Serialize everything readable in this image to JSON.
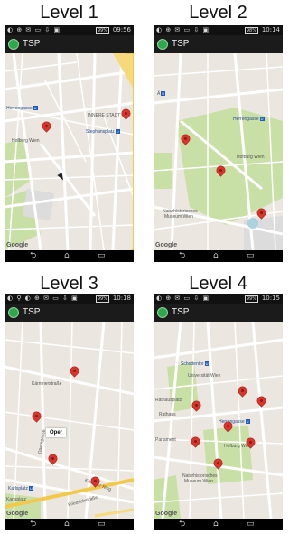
{
  "panels": [
    {
      "title": "Level 1",
      "status": {
        "left_icons": "◐ ⊕ ✉ ▭ ⇩ ▣",
        "right_icons": "⚲ ≪ ⧖ ✈",
        "battery": "99%",
        "time": "09:56"
      },
      "app": {
        "title": "TSP"
      },
      "labels": {
        "a": "Herrengasse",
        "b": "INNERE STADT",
        "c": "Stephansplatz",
        "d": "Hofburg Wien"
      },
      "google": "Google",
      "nav": {
        "back": "⮌",
        "home": "⌂",
        "recent": "▭"
      }
    },
    {
      "title": "Level 2",
      "status": {
        "left_icons": "◐ ⊕ ✉ ▭ ⇩ ▣",
        "right_icons": "≪ ⧖ ✈",
        "battery": "98%",
        "time": "10:14"
      },
      "app": {
        "title": "TSP"
      },
      "labels": {
        "a": "Herrengasse",
        "b": "Hofburg Wien",
        "c": "Naturhistorisches",
        "d": "Museum Wien"
      },
      "google": "Google",
      "nav": {
        "back": "⮌",
        "home": "⌂",
        "recent": "▭"
      }
    },
    {
      "title": "Level 3",
      "status": {
        "left_icons": "◐ ⚲ ◐ ⊕ ✉ ▭ ⇩ ▣",
        "right_icons": "⚲ ≪ ⧖ ✈",
        "battery": "99%",
        "time": "10:18"
      },
      "app": {
        "title": "TSP"
      },
      "labels": {
        "a": "Kärntnerstraße",
        "b": "Oper",
        "c": "Karlsplatz",
        "d": "Karlsplatz",
        "e": "Operngasse",
        "f": "Kärntner Ring",
        "g": "Friedrichstraße"
      },
      "google": "Google",
      "nav": {
        "back": "⮌",
        "home": "⌂",
        "recent": "▭"
      }
    },
    {
      "title": "Level 4",
      "status": {
        "left_icons": "◐ ⊕ ✉ ▭ ⇩ ▣",
        "right_icons": "≪ ⧖ ✈",
        "battery": "99%",
        "time": "10:15"
      },
      "app": {
        "title": "TSP"
      },
      "labels": {
        "a": "Schottentor",
        "b": "Universität Wien",
        "c": "Rathausplatz",
        "d": "Herrengasse",
        "e": "Hofburg Wien",
        "f": "Naturhistorisches",
        "g": "Museum Wien",
        "h": "Rathaus",
        "i": "Parlament"
      },
      "google": "Google",
      "nav": {
        "back": "⮌",
        "home": "⌂",
        "recent": "▭"
      }
    }
  ],
  "colors": {
    "pin": "#d9352b",
    "park": "#c8dfa5",
    "road": "#ffffff",
    "water": "#aad3df",
    "map_bg": "#ebe7e0"
  }
}
